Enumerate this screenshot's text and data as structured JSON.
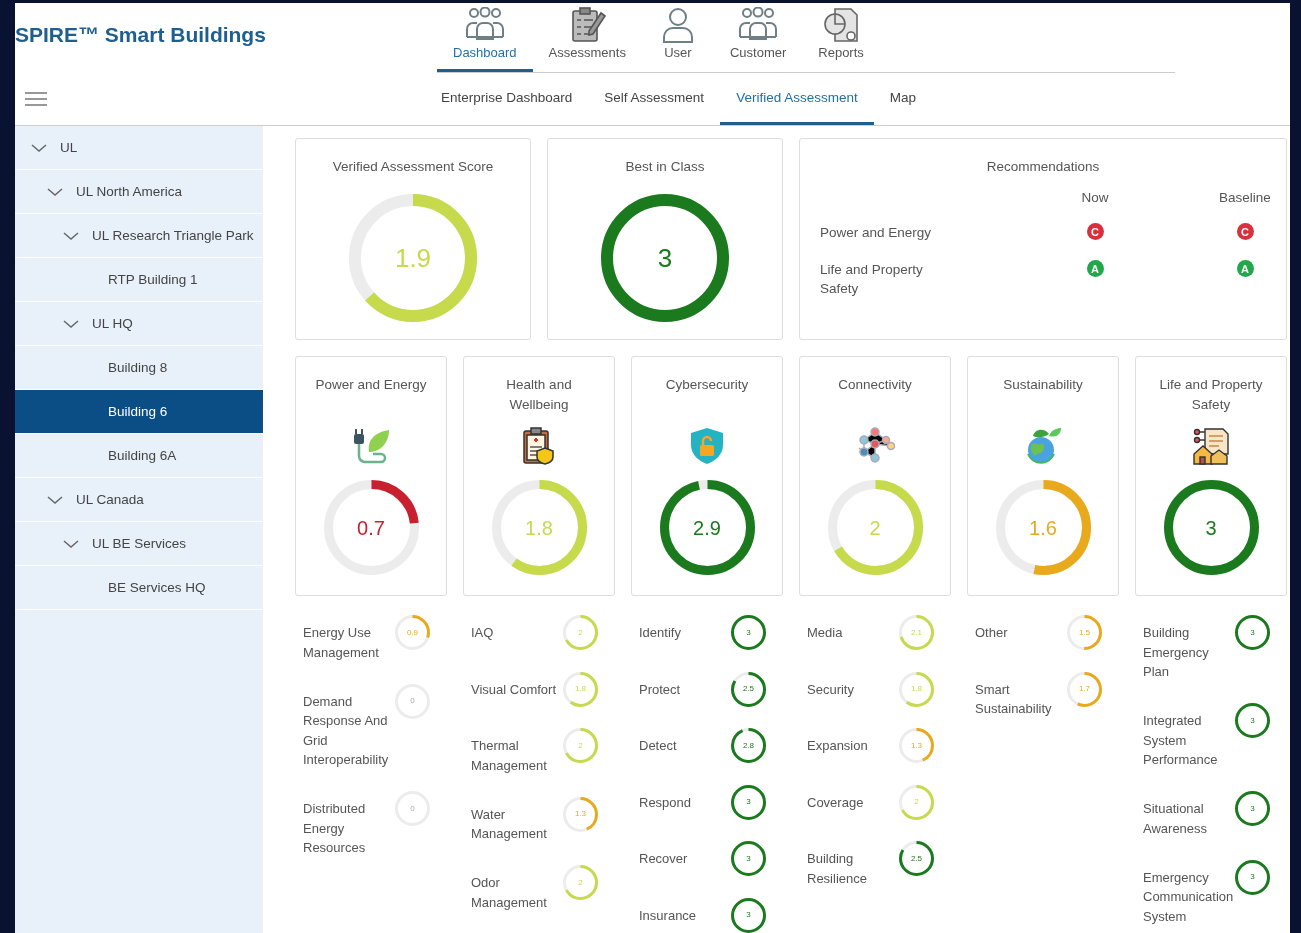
{
  "app": {
    "title": "SPIRE™ Smart Buildings"
  },
  "main_nav": [
    {
      "label": "Dashboard",
      "selected": true
    },
    {
      "label": "Assessments",
      "selected": false
    },
    {
      "label": "User",
      "selected": false
    },
    {
      "label": "Customer",
      "selected": false
    },
    {
      "label": "Reports",
      "selected": false
    }
  ],
  "sub_nav": [
    {
      "label": "Enterprise Dashboard",
      "selected": false
    },
    {
      "label": "Self Assessment",
      "selected": false
    },
    {
      "label": "Verified Assessment",
      "selected": true
    },
    {
      "label": "Map",
      "selected": false
    }
  ],
  "tree": [
    {
      "label": "UL",
      "expanded": true,
      "selected": false,
      "children": [
        {
          "label": "UL North America",
          "expanded": true,
          "selected": false,
          "children": [
            {
              "label": "UL Research Triangle Park",
              "expanded": true,
              "selected": false,
              "children": [
                {
                  "label": "RTP Building 1",
                  "selected": false
                }
              ]
            },
            {
              "label": "UL HQ",
              "expanded": true,
              "selected": false,
              "children": [
                {
                  "label": "Building 8",
                  "selected": false
                },
                {
                  "label": "Building 6",
                  "selected": true
                },
                {
                  "label": "Building 6A",
                  "selected": false
                }
              ]
            }
          ]
        },
        {
          "label": "UL Canada",
          "expanded": true,
          "selected": false,
          "children": [
            {
              "label": "UL BE Services",
              "expanded": true,
              "selected": false,
              "children": [
                {
                  "label": "BE Services HQ",
                  "selected": false
                }
              ]
            }
          ]
        }
      ]
    }
  ],
  "score_cards": [
    {
      "title": "Verified Assessment Score",
      "reading": "1.9"
    },
    {
      "title": "Best in Class",
      "reading": "3"
    }
  ],
  "recommendations": {
    "title": "Recommendations",
    "columns": [
      "Now",
      "Baseline"
    ],
    "rows": [
      {
        "label": "Power and Energy",
        "grades": [
          {
            "grade": "C",
            "color": "#d9303e"
          },
          {
            "grade": "C",
            "color": "#d9303e"
          }
        ]
      },
      {
        "label": "Life and Property Safety",
        "grades": [
          {
            "grade": "A",
            "color": "#22a84a"
          },
          {
            "grade": "A",
            "color": "#22a84a"
          }
        ]
      }
    ]
  },
  "categories": [
    {
      "title": "Power and Energy",
      "reading": "0.7",
      "items": [
        {
          "label": "Energy Use Management",
          "reading": "0.9"
        },
        {
          "label": "Demand Response And Grid Interoperability",
          "reading": "0"
        },
        {
          "label": "Distributed Energy Resources",
          "reading": "0"
        }
      ]
    },
    {
      "title": "Health and Wellbeing",
      "reading": "1.8",
      "items": [
        {
          "label": "IAQ",
          "reading": "2"
        },
        {
          "label": "Visual Comfort",
          "reading": "1.8"
        },
        {
          "label": "Thermal Management",
          "reading": "2"
        },
        {
          "label": "Water Management",
          "reading": "1.3"
        },
        {
          "label": "Odor Management",
          "reading": "2"
        }
      ]
    },
    {
      "title": "Cybersecurity",
      "reading": "2.9",
      "items": [
        {
          "label": "Identify",
          "reading": "3"
        },
        {
          "label": "Protect",
          "reading": "2.5"
        },
        {
          "label": "Detect",
          "reading": "2.8"
        },
        {
          "label": "Respond",
          "reading": "3"
        },
        {
          "label": "Recover",
          "reading": "3"
        },
        {
          "label": "Insurance",
          "reading": "3"
        }
      ]
    },
    {
      "title": "Connectivity",
      "reading": "2",
      "items": [
        {
          "label": "Media",
          "reading": "2.1"
        },
        {
          "label": "Security",
          "reading": "1.8"
        },
        {
          "label": "Expansion",
          "reading": "1.3"
        },
        {
          "label": "Coverage",
          "reading": "2"
        },
        {
          "label": "Building Resilience",
          "reading": "2.5"
        }
      ]
    },
    {
      "title": "Sustainability",
      "reading": "1.6",
      "items": [
        {
          "label": "Other",
          "reading": "1.5"
        },
        {
          "label": "Smart Sustainability",
          "reading": "1.7"
        }
      ]
    },
    {
      "title": "Life and Property Safety",
      "reading": "3",
      "items": [
        {
          "label": "Building Emergency Plan",
          "reading": "3"
        },
        {
          "label": "Integrated System Performance",
          "reading": "3"
        },
        {
          "label": "Situational Awareness",
          "reading": "3"
        },
        {
          "label": "Emergency Communication System",
          "reading": "3"
        }
      ]
    }
  ]
}
